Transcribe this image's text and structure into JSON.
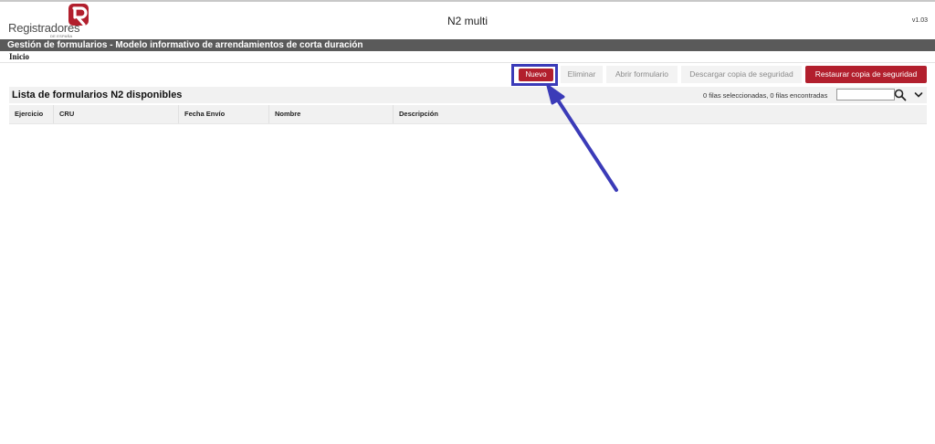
{
  "header": {
    "logo_text": "Registradores",
    "logo_subtext": "DE ESPAÑA",
    "app_title": "N2 multi",
    "version": "v1.03"
  },
  "titlebar": {
    "text": "Gestión de formularios - Modelo informativo de arrendamientos de corta duración"
  },
  "breadcrumb": {
    "home": "Inicio"
  },
  "toolbar": {
    "new_label": "Nuevo",
    "delete_label": "Eliminar",
    "open_label": "Abrir formulario",
    "download_label": "Descargar copia de seguridad",
    "restore_label": "Restaurar copia de seguridad"
  },
  "list": {
    "title": "Lista de formularios N2 disponibles",
    "status": "0 filas seleccionadas, 0 filas encontradas",
    "search_value": "",
    "columns": [
      "Ejercicio",
      "CRU",
      "Fecha Envío",
      "Nombre",
      "Descripción"
    ],
    "rows": []
  },
  "colors": {
    "accent_red": "#b21f2d",
    "highlight_blue": "#3b3bb8",
    "titlebar_gray": "#5a5a5a"
  },
  "icons": [
    "registradores-logo-icon",
    "search-icon",
    "chevron-down-icon"
  ]
}
